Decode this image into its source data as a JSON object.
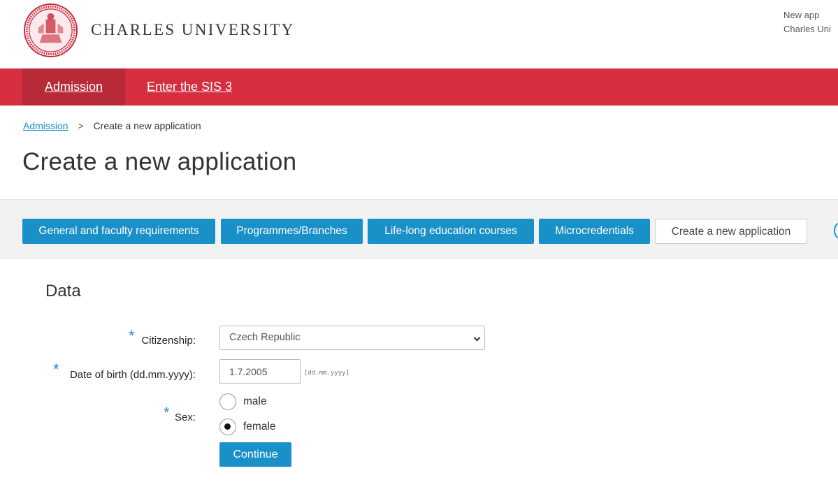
{
  "header": {
    "university_name": "CHARLES UNIVERSITY",
    "top_right_line1": "New app",
    "top_right_line2": "Charles Uni",
    "logo_icon": "university-seal-icon"
  },
  "nav": {
    "items": [
      {
        "label": "Admission",
        "active": true
      },
      {
        "label": "Enter the SIS 3",
        "active": false
      }
    ]
  },
  "breadcrumb": {
    "parent": "Admission",
    "separator": ">",
    "current": "Create a new application"
  },
  "page_title": "Create a new application",
  "tabs": [
    {
      "label": "General and faculty requirements"
    },
    {
      "label": "Programmes/Branches"
    },
    {
      "label": "Life-long education courses"
    },
    {
      "label": "Microcredentials"
    },
    {
      "label": "Create a new application"
    }
  ],
  "form": {
    "section_title": "Data",
    "required_marker": "*",
    "citizenship": {
      "label": "Citizenship:",
      "value": "Czech Republic"
    },
    "birth_date": {
      "label": "Date of birth (dd.mm.yyyy):",
      "value": "1.7.2005",
      "hint": "[dd.mm.yyyy]"
    },
    "sex": {
      "label": "Sex:",
      "options": [
        {
          "label": "male",
          "checked": false
        },
        {
          "label": "female",
          "checked": true
        }
      ]
    },
    "continue_label": "Continue"
  },
  "colors": {
    "brand_red": "#d42e3f",
    "accent_blue": "#1a90c8"
  }
}
